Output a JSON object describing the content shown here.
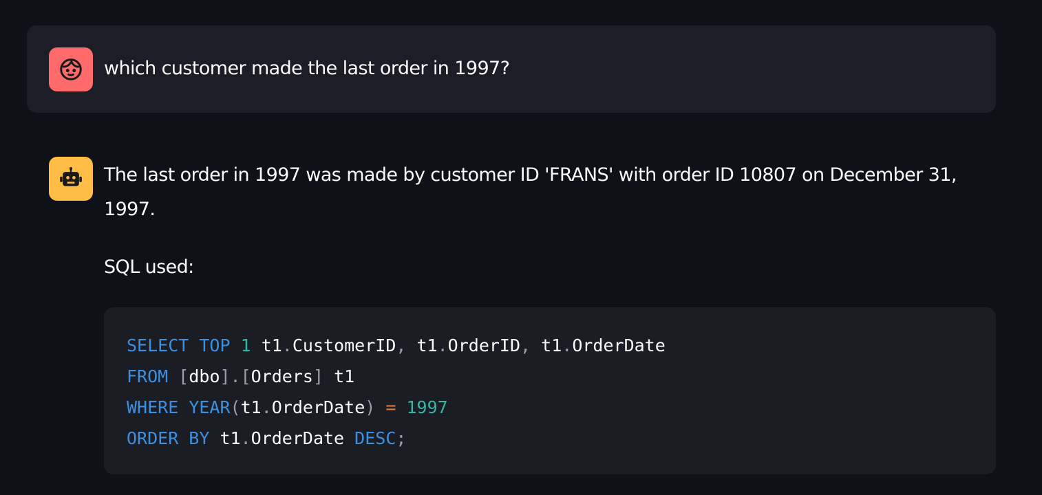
{
  "colors": {
    "background": "#0e1117",
    "user_bubble": "#1c1d26",
    "user_avatar": "#ff6b6b",
    "assistant_avatar": "#ffbd45",
    "code_background": "#1b1d25",
    "sql_keyword": "#3d8fe0",
    "sql_number": "#35b5a4",
    "sql_operator": "#e07a3f",
    "sql_punctuation": "#9aa0a8"
  },
  "chat": {
    "user_message": {
      "avatar_icon": "face-icon",
      "text": "which customer made the last order in 1997?"
    },
    "assistant_message": {
      "avatar_icon": "robot-icon",
      "answer": "The last order in 1997 was made by customer ID 'FRANS' with order ID 10807 on December 31, 1997.",
      "sql_label": "SQL used:",
      "sql_lines": [
        [
          {
            "t": "SELECT",
            "k": "kw"
          },
          {
            "t": " ",
            "k": "plain"
          },
          {
            "t": "TOP",
            "k": "kw"
          },
          {
            "t": " ",
            "k": "plain"
          },
          {
            "t": "1",
            "k": "num"
          },
          {
            "t": " t1",
            "k": "plain"
          },
          {
            "t": ".",
            "k": "punc"
          },
          {
            "t": "CustomerID",
            "k": "plain"
          },
          {
            "t": ",",
            "k": "punc"
          },
          {
            "t": " t1",
            "k": "plain"
          },
          {
            "t": ".",
            "k": "punc"
          },
          {
            "t": "OrderID",
            "k": "plain"
          },
          {
            "t": ",",
            "k": "punc"
          },
          {
            "t": " t1",
            "k": "plain"
          },
          {
            "t": ".",
            "k": "punc"
          },
          {
            "t": "OrderDate",
            "k": "plain"
          }
        ],
        [
          {
            "t": "FROM",
            "k": "kw"
          },
          {
            "t": " ",
            "k": "plain"
          },
          {
            "t": "[",
            "k": "punc"
          },
          {
            "t": "dbo",
            "k": "plain"
          },
          {
            "t": "].[",
            "k": "punc"
          },
          {
            "t": "Orders",
            "k": "plain"
          },
          {
            "t": "]",
            "k": "punc"
          },
          {
            "t": " t1",
            "k": "plain"
          }
        ],
        [
          {
            "t": "WHERE",
            "k": "kw"
          },
          {
            "t": " ",
            "k": "plain"
          },
          {
            "t": "YEAR",
            "k": "kw"
          },
          {
            "t": "(",
            "k": "punc"
          },
          {
            "t": "t1",
            "k": "plain"
          },
          {
            "t": ".",
            "k": "punc"
          },
          {
            "t": "OrderDate",
            "k": "plain"
          },
          {
            "t": ")",
            "k": "punc"
          },
          {
            "t": " ",
            "k": "plain"
          },
          {
            "t": "=",
            "k": "op"
          },
          {
            "t": " ",
            "k": "plain"
          },
          {
            "t": "1997",
            "k": "num"
          }
        ],
        [
          {
            "t": "ORDER BY",
            "k": "kw"
          },
          {
            "t": " t1",
            "k": "plain"
          },
          {
            "t": ".",
            "k": "punc"
          },
          {
            "t": "OrderDate",
            "k": "plain"
          },
          {
            "t": " ",
            "k": "plain"
          },
          {
            "t": "DESC",
            "k": "kw"
          },
          {
            "t": ";",
            "k": "punc"
          }
        ]
      ]
    }
  }
}
